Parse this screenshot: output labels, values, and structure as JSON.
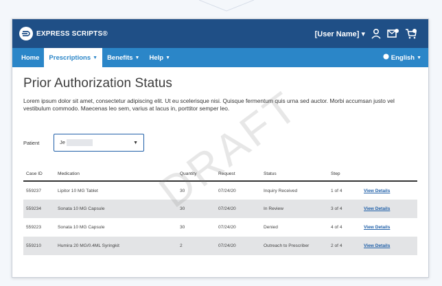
{
  "brand": {
    "name": "EXPRESS SCRIPTS",
    "name_suffix": "®"
  },
  "header": {
    "user_name": "[User Name]",
    "user_caret": "▾"
  },
  "nav": {
    "items": [
      {
        "label": "Home",
        "has_caret": false
      },
      {
        "label": "Prescriptions",
        "has_caret": true
      },
      {
        "label": "Benefits",
        "has_caret": true
      },
      {
        "label": "Help",
        "has_caret": true
      }
    ],
    "active_index": 1,
    "language": "English"
  },
  "page": {
    "title": "Prior Authorization Status",
    "intro": "Lorem ipsum dolor sit amet, consectetur adipiscing elit. Ut eu scelerisque nisi. Quisque fermentum quis urna sed auctor. Morbi accumsan justo vel vestibulum commodo. Maecenas leo sem, varius at lacus in, porttitor semper leo."
  },
  "patient": {
    "label": "Patient",
    "value_visible": "Je"
  },
  "table": {
    "headers": [
      "Case ID",
      "Medication",
      "Quantity",
      "Request",
      "Status",
      "Step",
      ""
    ],
    "rows": [
      {
        "case_id": "559237",
        "medication": "Lipitor 10 MG Tablet",
        "quantity": "30",
        "requested": "07/24/20",
        "status": "Inquiry Received",
        "step": "1 of 4",
        "action": "View Details",
        "shaded": false
      },
      {
        "case_id": "559234",
        "medication": "Sonata 10 MG Capsule",
        "quantity": "30",
        "requested": "07/24/20",
        "status": "In Review",
        "step": "3 of 4",
        "action": "View Details",
        "shaded": true
      },
      {
        "case_id": "559223",
        "medication": "Sonata 10 MG Capsule",
        "quantity": "30",
        "requested": "07/24/20",
        "status": "Denied",
        "step": "4 of 4",
        "action": "View Details",
        "shaded": false
      },
      {
        "case_id": "559210",
        "medication": "Humira 20 MG/0.4ML Syringkit",
        "quantity": "2",
        "requested": "07/24/20",
        "status": "Outreach to Prescriber",
        "step": "2 of 4",
        "action": "View Details",
        "shaded": true
      }
    ]
  },
  "watermark": "DRAFT",
  "colors": {
    "header": "#1f4f86",
    "nav": "#2b86c8",
    "link": "#1f5fa8"
  }
}
